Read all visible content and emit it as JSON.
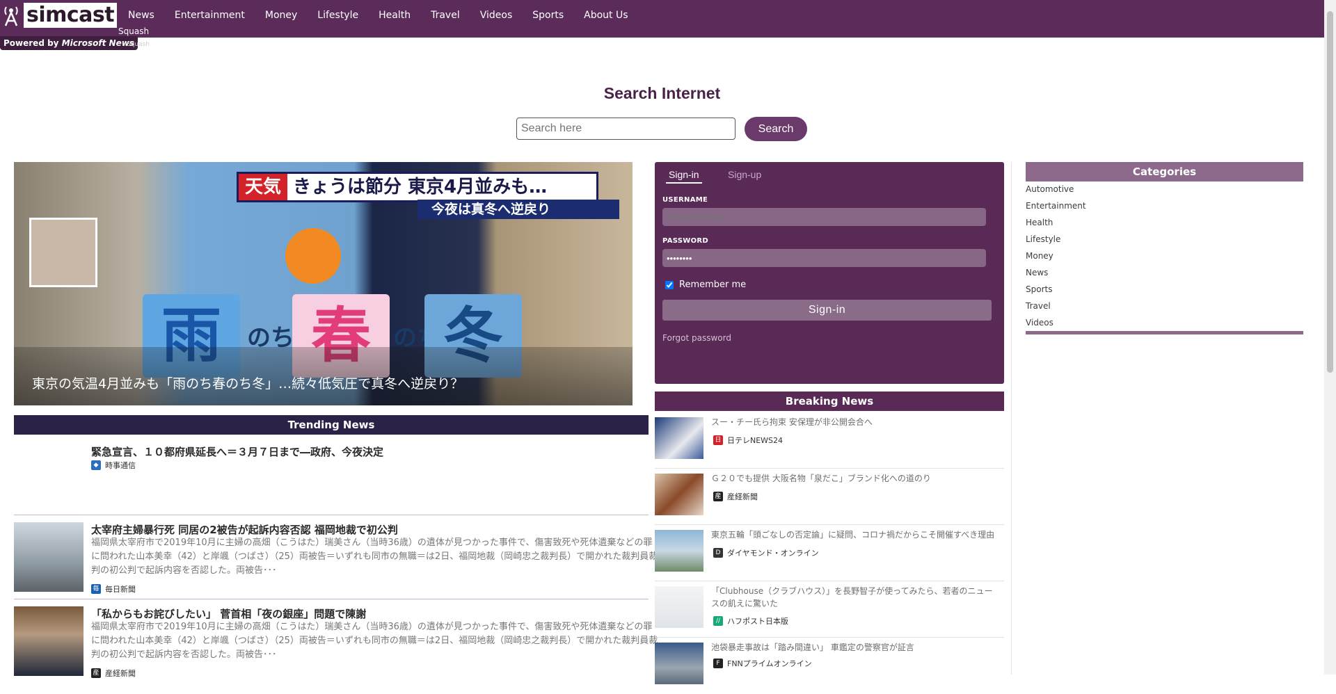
{
  "brand": {
    "name": "simcast",
    "powered_prefix": "Powered by",
    "powered_brand": "Microsoft News"
  },
  "nav": {
    "items": [
      "News",
      "Entertainment",
      "Money",
      "Lifestyle",
      "Health",
      "Travel",
      "Videos",
      "Sports",
      "About Us"
    ],
    "sub_item": "Squash",
    "sub_ghost": "Squash"
  },
  "search": {
    "title": "Search Internet",
    "placeholder": "Search here",
    "button": "Search"
  },
  "hero": {
    "caption": "東京の気温4月並みも「雨のち春のち冬」…続々低気圧で真冬へ逆戻り？",
    "banner_badge": "天気",
    "banner_text": "きょうは節分 東京4月並みも…",
    "banner_sub": "今夜は真冬へ逆戻り",
    "kanji": [
      "雨",
      "春",
      "冬"
    ],
    "nochi": "のち"
  },
  "trending": {
    "header": "Trending News",
    "items": [
      {
        "title": "緊急宣言、１０都府県延長へ＝３月７日まで―政府、今夜決定",
        "body": "",
        "source": "時事通信",
        "icon_color": "#2a6fc0"
      },
      {
        "title": "太宰府主婦暴行死 同居の2被告が起訴内容否認 福岡地裁で初公判",
        "body": "福岡県太宰府市で2019年10月に主婦の高畑（こうはた）瑞美さん（当時36歳）の遺体が見つかった事件で、傷害致死や死体遺棄などの罪に問われた山本美幸（42）と岸颯（つばさ）（25）両被告＝いずれも同市の無職＝は2日、福岡地裁（岡崎忠之裁判長）で開かれた裁判員裁判の初公判で起訴内容を否認した。両被告･･･",
        "source": "毎日新聞",
        "icon_color": "#1a5fb4"
      },
      {
        "title": "「私からもお詫びしたい」 菅首相「夜の銀座」問題で陳謝",
        "body": "福岡県太宰府市で2019年10月に主婦の高畑（こうはた）瑞美さん（当時36歳）の遺体が見つかった事件で、傷害致死や死体遺棄などの罪に問われた山本美幸（42）と岸颯（つばさ）（25）両被告＝いずれも同市の無職＝は2日、福岡地裁（岡崎忠之裁判長）で開かれた裁判員裁判の初公判で起訴内容を否認した。両被告･･･",
        "source": "産経新聞",
        "icon_color": "#222222"
      }
    ]
  },
  "signin": {
    "tab_signin": "Sign-in",
    "tab_signup": "Sign-up",
    "username_label": "USERNAME",
    "username_placeholder": "Email Address",
    "password_label": "PASSWORD",
    "password_value": "••••••••",
    "remember": "Remember me",
    "button": "Sign-in",
    "forgot": "Forgot password"
  },
  "breaking": {
    "header": "Breaking News",
    "items": [
      {
        "title": "スー・チー氏ら拘束 安保理が非公開会合へ",
        "source": "日テレNEWS24",
        "icon_color": "#d3222a"
      },
      {
        "title": "Ｇ２０でも提供 大阪名物「泉だこ」ブランド化への道のり",
        "source": "産経新聞",
        "icon_color": "#222222"
      },
      {
        "title": "東京五輪「頭ごなしの否定論」に疑問、コロナ禍だからこそ開催すべき理由",
        "source": "ダイヤモンド・オンライン",
        "icon_color": "#333333"
      },
      {
        "title": "「Clubhouse（クラブハウス）」を長野智子が使ってみたら、若者のニュースの飢えに驚いた",
        "source": "ハフポスト日本版",
        "icon_color": "#1aa87a"
      },
      {
        "title": "池袋暴走事故は「踏み間違い」 車鑑定の警察官が証言",
        "source": "FNNプライムオンライン",
        "icon_color": "#222222"
      }
    ]
  },
  "categories": {
    "header": "Categories",
    "items": [
      "Automotive",
      "Entertainment",
      "Health",
      "Lifestyle",
      "Money",
      "News",
      "Sports",
      "Travel",
      "Videos"
    ]
  },
  "colors": {
    "brand": "#5b2c5a",
    "trending_bar": "#2c2248",
    "categories": "#8d6a8b"
  }
}
